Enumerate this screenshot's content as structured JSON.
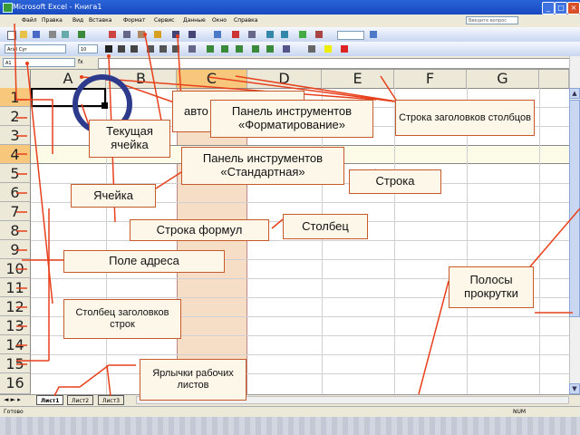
{
  "window": {
    "title": "Microsoft Excel - Книга1",
    "buttons": [
      "_",
      "□",
      "×"
    ]
  },
  "menu": {
    "items": [
      "Файл",
      "Правка",
      "Вид",
      "Вставка",
      "Формат",
      "Сервис",
      "Данные",
      "Окно",
      "Справка"
    ],
    "help_placeholder": "Введите вопрос"
  },
  "toolbar": {
    "font": "Arial Cyr",
    "size": "10"
  },
  "formula_bar": {
    "name_box": "A1",
    "fx": "fx"
  },
  "columns": [
    "A",
    "B",
    "C",
    "D",
    "E",
    "F",
    "G"
  ],
  "rows": [
    "1",
    "2",
    "3",
    "4",
    "5",
    "6",
    "7",
    "8",
    "9",
    "10",
    "11",
    "12",
    "13",
    "14",
    "15",
    "16"
  ],
  "sheets": [
    "Лист1",
    "Лист2",
    "Лист3"
  ],
  "status": {
    "left": "Готово",
    "right": "NUM"
  },
  "callouts": {
    "autofill": "авто",
    "current_cell": "Текущая ячейка",
    "formatting_toolbar": "Панель инструментов «Форматирование»",
    "column_headers_row": "Строка заголовков столбцов",
    "standard_toolbar": "Панель инструментов «Стандартная»",
    "row": "Строка",
    "cell": "Ячейка",
    "column": "Столбец",
    "formula_bar": "Строка формул",
    "name_box": "Поле адреса",
    "scrollbars": "Полосы прокрутки",
    "row_headers_column": "Столбец заголовков строк",
    "sheet_tabs": "Ярлычки рабочих листов"
  },
  "colors": {
    "accent": "#e8401c",
    "title_blue": "#1f5ad0",
    "selected_header": "#f7c77c"
  }
}
